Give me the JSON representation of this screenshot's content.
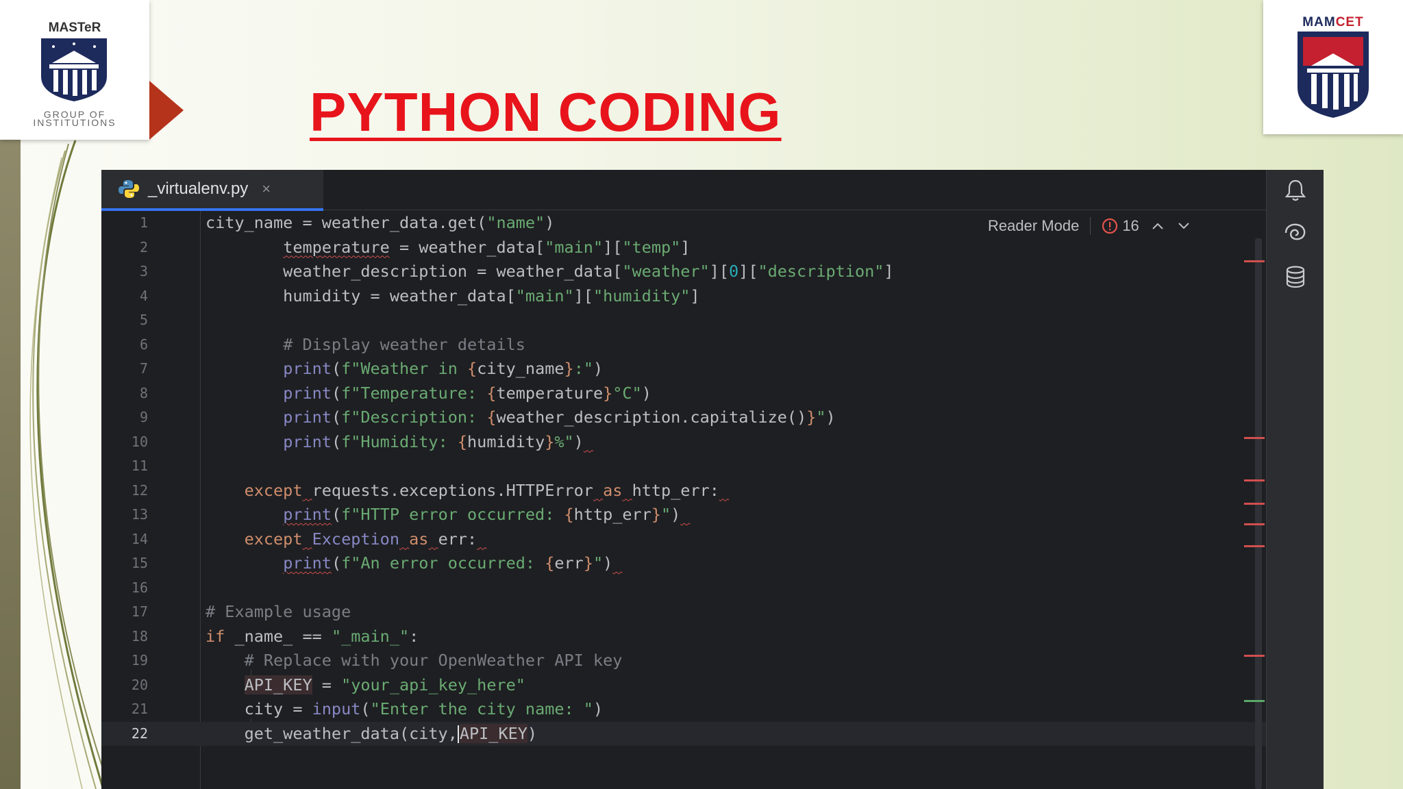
{
  "slide": {
    "title": "PYTHON CODING",
    "logo_left": {
      "name": "MASTeR",
      "sub_line1": "GROUP OF",
      "sub_line2": "INSTITUTIONS"
    },
    "logo_right": {
      "name_part1": "MAM",
      "name_part2": "CET"
    }
  },
  "colors": {
    "title": "#e8141b",
    "accent_arrow": "#b5331a",
    "editor_bg": "#1e1f22",
    "tab_active_underline": "#3574f0",
    "error": "#d14f4f",
    "keyword": "#cf8e6d",
    "string": "#6aab73",
    "comment": "#7a7e85"
  },
  "editor": {
    "tab": {
      "filename": "_virtualenv.py",
      "icon": "python-file-icon",
      "close": "×"
    },
    "reader_mode": "Reader Mode",
    "error_count": "16",
    "nav_up": "^",
    "nav_down": "v",
    "toolbar_icons": [
      "bell-icon",
      "ai-swirl-icon",
      "database-icon"
    ],
    "current_line": 22,
    "lines": [
      {
        "n": "1",
        "text": "city_name = weather_data.get(\"name\")"
      },
      {
        "n": "2",
        "text": "temperature = weather_data[\"main\"][\"temp\"]"
      },
      {
        "n": "3",
        "text": "weather_description = weather_data[\"weather\"][0][\"description\"]"
      },
      {
        "n": "4",
        "text": "humidity = weather_data[\"main\"][\"humidity\"]"
      },
      {
        "n": "5",
        "text": ""
      },
      {
        "n": "6",
        "text": "# Display weather details"
      },
      {
        "n": "7",
        "text": "print(f\"Weather in {city_name}:\")"
      },
      {
        "n": "8",
        "text": "print(f\"Temperature: {temperature}°C\")"
      },
      {
        "n": "9",
        "text": "print(f\"Description: {weather_description.capitalize()}\")"
      },
      {
        "n": "10",
        "text": "print(f\"Humidity: {humidity}%\")"
      },
      {
        "n": "11",
        "text": ""
      },
      {
        "n": "12",
        "text": "except requests.exceptions.HTTPError as http_err:"
      },
      {
        "n": "13",
        "text": "print(f\"HTTP error occurred: {http_err}\")"
      },
      {
        "n": "14",
        "text": "except Exception as err:"
      },
      {
        "n": "15",
        "text": "print(f\"An error occurred: {err}\")"
      },
      {
        "n": "16",
        "text": ""
      },
      {
        "n": "17",
        "text": "# Example usage"
      },
      {
        "n": "18",
        "text": "if _name_ == \"_main_\":"
      },
      {
        "n": "19",
        "text": "# Replace with your OpenWeather API key"
      },
      {
        "n": "20",
        "text": "API_KEY = \"your_api_key_here\""
      },
      {
        "n": "21",
        "text": "city = input(\"Enter the city name: \")"
      },
      {
        "n": "22",
        "text": "get_weather_data(city,API_KEY)"
      }
    ]
  }
}
